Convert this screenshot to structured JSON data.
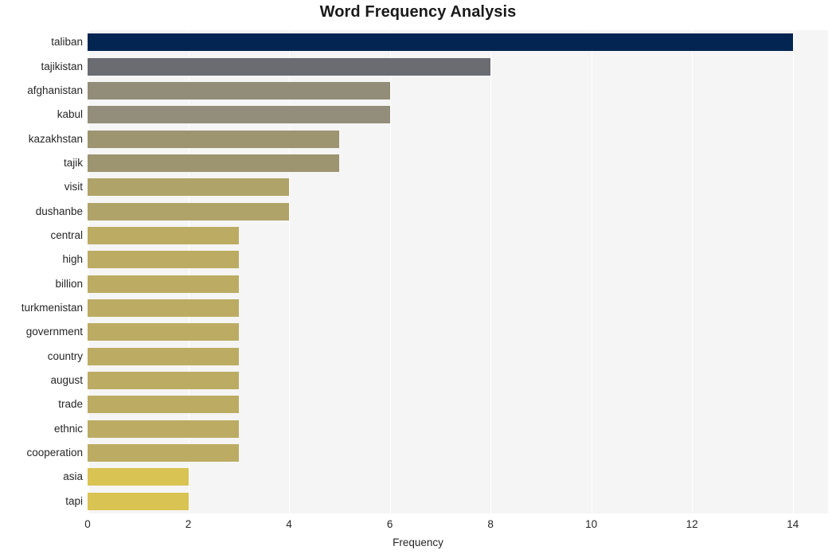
{
  "chart_data": {
    "type": "bar",
    "orientation": "horizontal",
    "title": "Word Frequency Analysis",
    "xlabel": "Frequency",
    "ylabel": "",
    "xlim": [
      0,
      14.7
    ],
    "ylim": [
      0,
      20
    ],
    "grid": true,
    "legend": null,
    "x_ticks": [
      "0",
      "2",
      "4",
      "6",
      "8",
      "10",
      "12",
      "14"
    ],
    "x_tick_values": [
      0,
      2,
      4,
      6,
      8,
      10,
      12,
      14
    ],
    "categories": [
      "taliban",
      "tajikistan",
      "afghanistan",
      "kabul",
      "kazakhstan",
      "tajik",
      "visit",
      "dushanbe",
      "central",
      "high",
      "billion",
      "turkmenistan",
      "government",
      "country",
      "august",
      "trade",
      "ethnic",
      "cooperation",
      "asia",
      "tapi"
    ],
    "values": [
      14,
      8,
      6,
      6,
      5,
      5,
      4,
      4,
      3,
      3,
      3,
      3,
      3,
      3,
      3,
      3,
      3,
      3,
      2,
      2
    ],
    "bar_colors": [
      "#032551",
      "#6b6c72",
      "#918d78",
      "#938e7c",
      "#9d9470",
      "#9d9470",
      "#b0a369",
      "#b0a369",
      "#bcac63",
      "#bcac63",
      "#bcac63",
      "#bcac63",
      "#bcac63",
      "#bcac63",
      "#bcac63",
      "#bcac63",
      "#bcac63",
      "#bcac63",
      "#d9c352",
      "#d9c352"
    ]
  },
  "style": {
    "plot_background": "#f5f5f5",
    "page_background": "#ffffff",
    "gridline_color": "#ffffff",
    "title_color": "#1a1a1a",
    "tick_color": "#262626"
  }
}
